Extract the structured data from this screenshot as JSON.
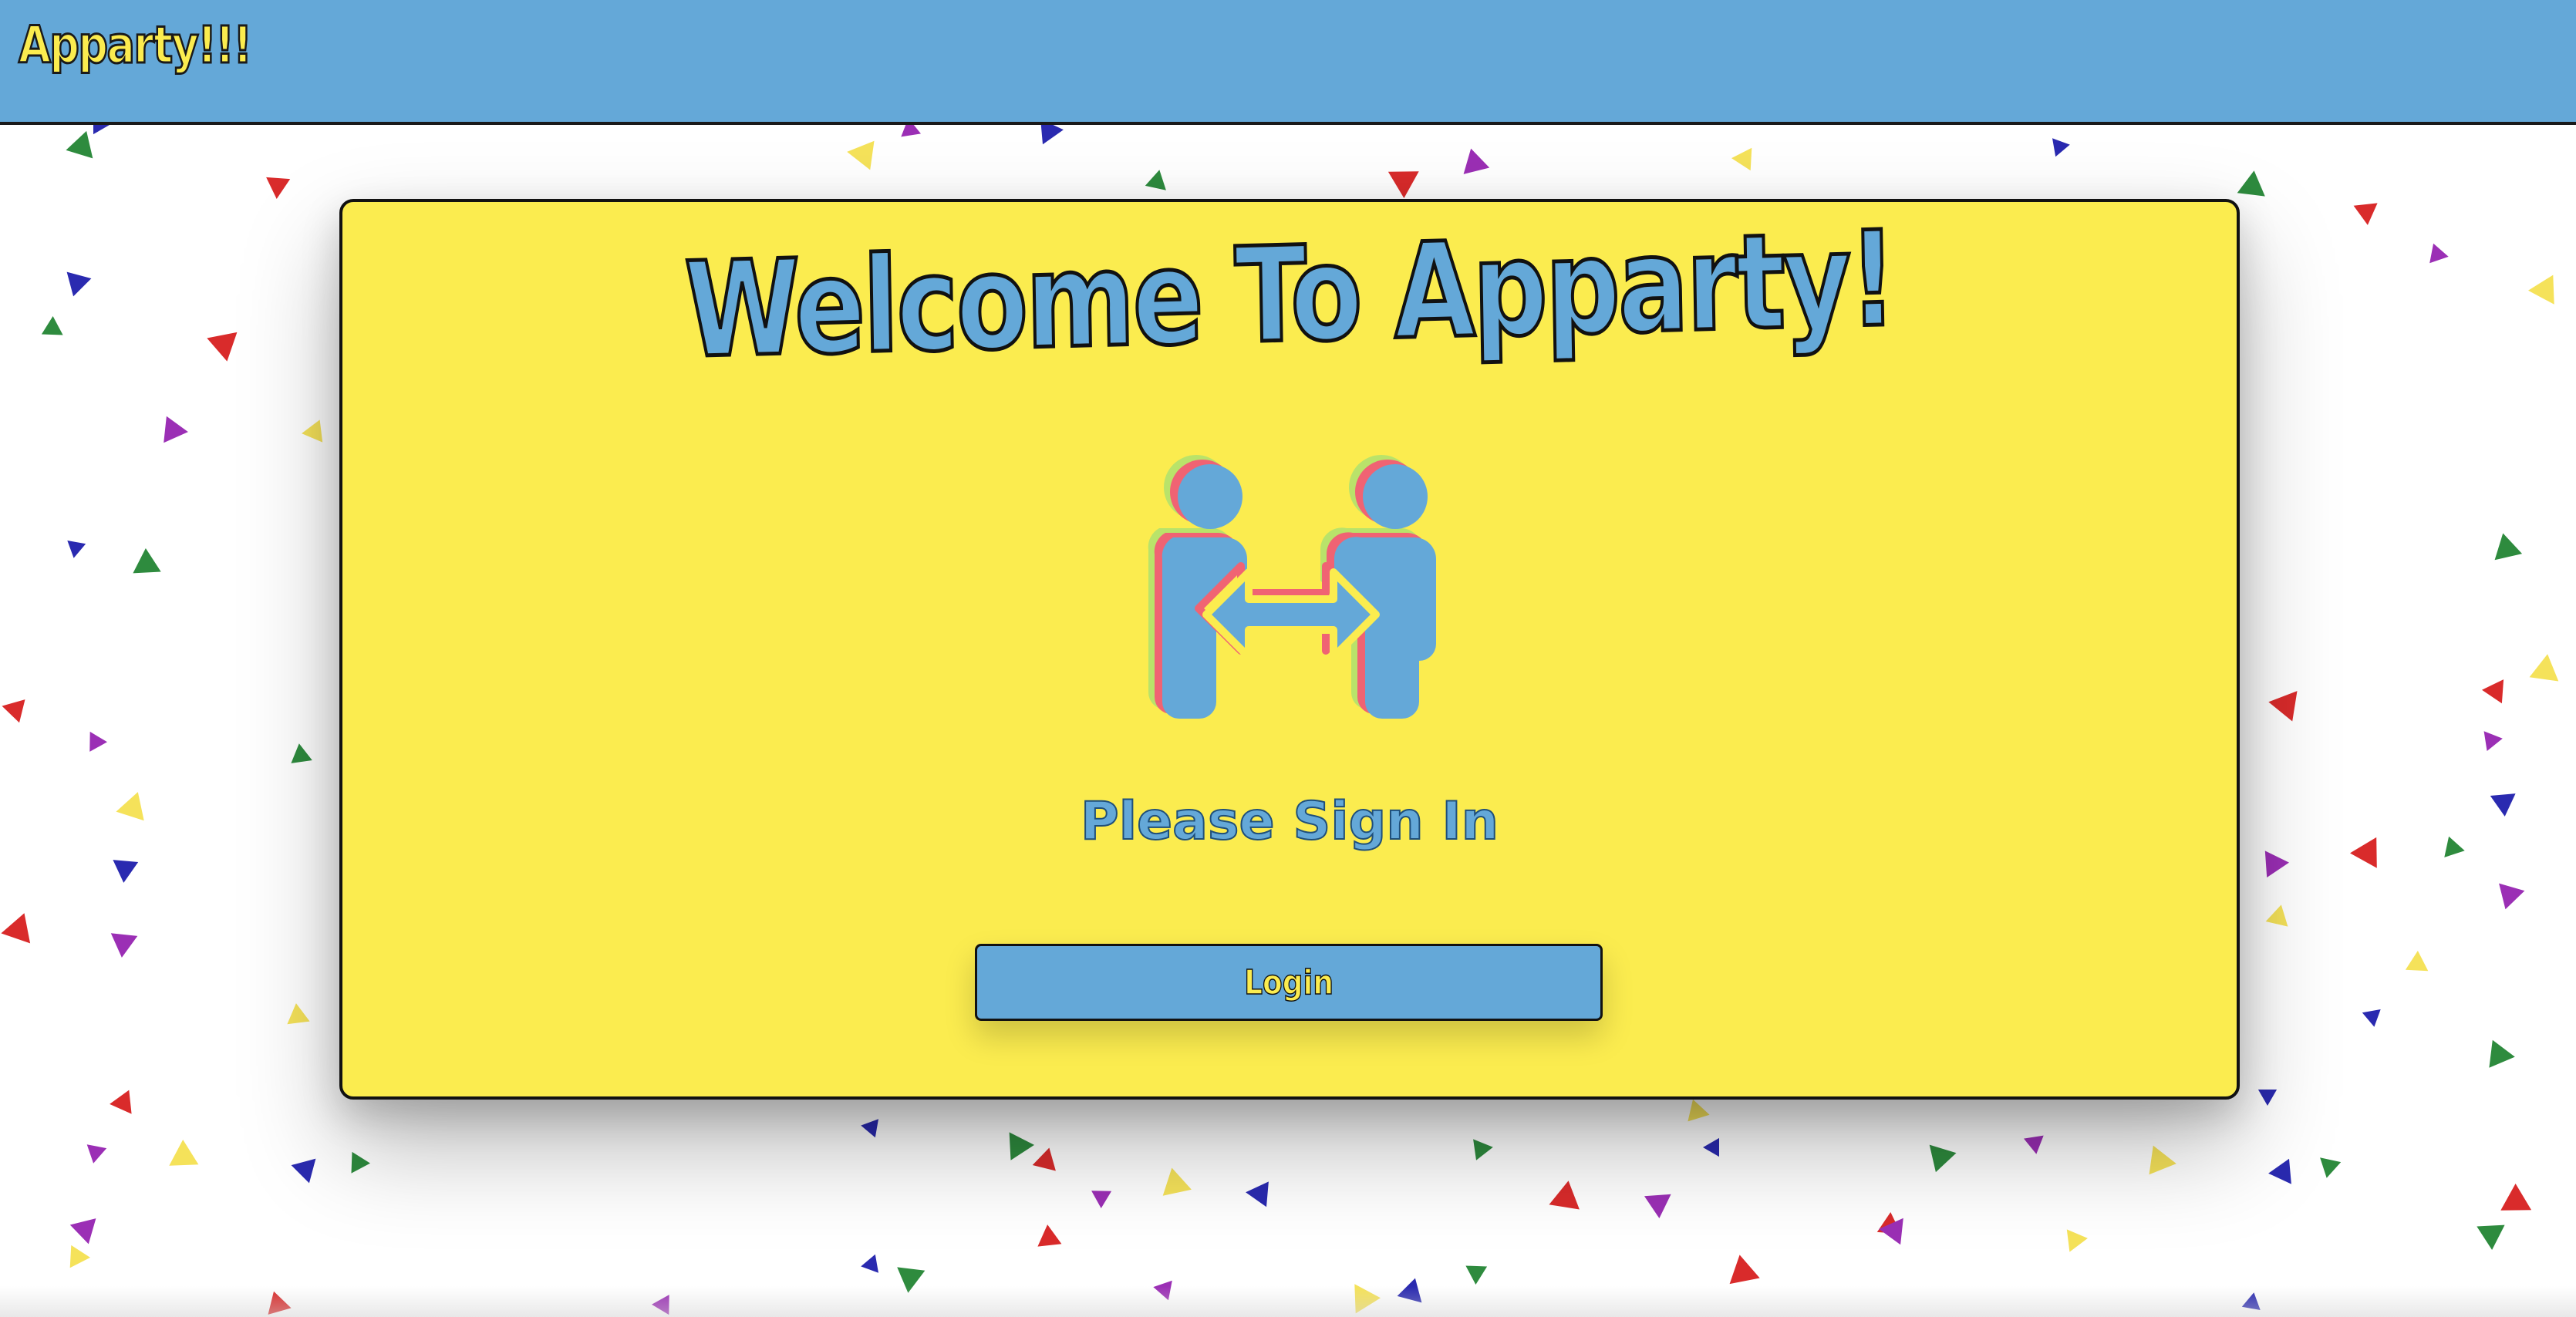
{
  "header": {
    "brand": "Apparty!!!"
  },
  "card": {
    "title": "Welcome To Apparty!",
    "subtitle": "Please Sign In",
    "login_label": "Login",
    "logo_icon": "people-exchange-icon"
  },
  "colors": {
    "header_bg": "#64a8d8",
    "card_bg": "#fbec4f",
    "accent_blue": "#64a8d8",
    "accent_yellow": "#fbec4f",
    "confetti": [
      "#2a2ab0",
      "#2e8b3e",
      "#d92b2b",
      "#9b2fb5",
      "#f5e25a"
    ]
  }
}
